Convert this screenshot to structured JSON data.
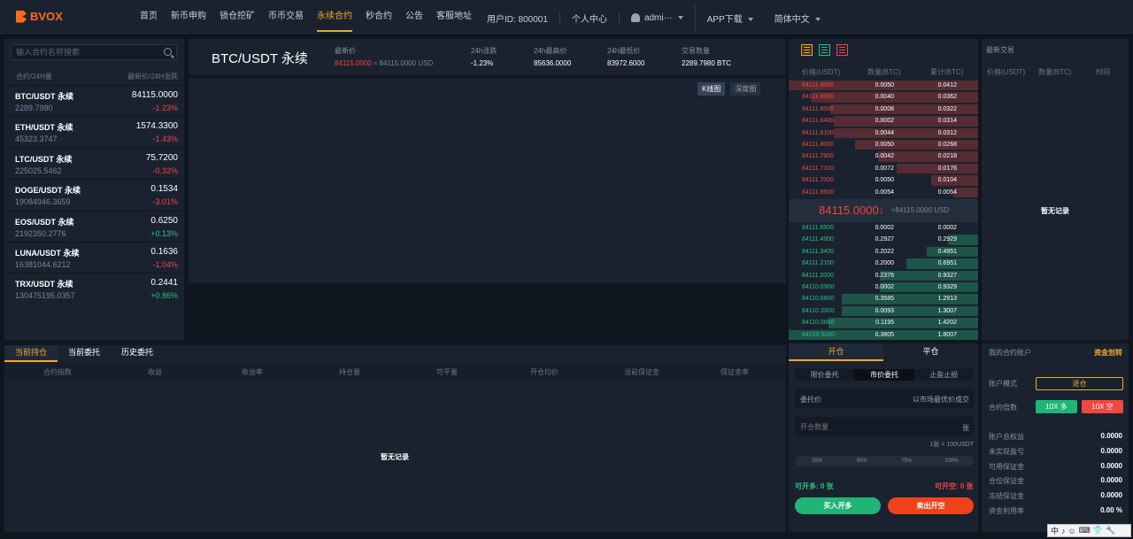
{
  "nav": {
    "logo": "BVOX",
    "items": [
      "首页",
      "新币申购",
      "锁仓挖矿",
      "币币交易",
      "永续合约",
      "秒合约",
      "公告",
      "客服地址"
    ],
    "active_index": 4,
    "user_id": "用户ID: 800001",
    "personal_center": "个人中心",
    "username": "admi···",
    "app_download": "APP下载",
    "language": "简体中文"
  },
  "market": {
    "search_placeholder": "输入合约名称搜索",
    "col_contract": "合约/24H量",
    "col_price": "最新价/24H涨跌",
    "rows": [
      {
        "symbol": "BTC/USDT 永续",
        "volume": "2289.7980",
        "price": "84115.0000",
        "change": "-1.23%",
        "dir": "down"
      },
      {
        "symbol": "ETH/USDT 永续",
        "volume": "45323.3747",
        "price": "1574.3300",
        "change": "-1.43%",
        "dir": "down"
      },
      {
        "symbol": "LTC/USDT 永续",
        "volume": "225025.5462",
        "price": "75.7200",
        "change": "-0.32%",
        "dir": "down"
      },
      {
        "symbol": "DOGE/USDT 永续",
        "volume": "19084946.3659",
        "price": "0.1534",
        "change": "-3.01%",
        "dir": "down"
      },
      {
        "symbol": "EOS/USDT 永续",
        "volume": "2192350.2776",
        "price": "0.6250",
        "change": "+0.13%",
        "dir": "up"
      },
      {
        "symbol": "LUNA/USDT 永续",
        "volume": "16381044.6212",
        "price": "0.1636",
        "change": "-1.04%",
        "dir": "down"
      },
      {
        "symbol": "TRX/USDT 永续",
        "volume": "130475195.0357",
        "price": "0.2441",
        "change": "+0.86%",
        "dir": "up"
      }
    ]
  },
  "ticker": {
    "pair": "BTC/USDT 永续",
    "last_label": "最新价",
    "last_price": "84115.0000",
    "last_usd": "≈ 84115.0000 USD",
    "change_label": "24h涨跌",
    "change": "-1.23%",
    "high_label": "24h最高价",
    "high": "85636.0000",
    "low_label": "24h最低价",
    "low": "83972.6000",
    "vol_label": "交易数量",
    "vol": "2289.7980 BTC"
  },
  "chart": {
    "tabs": [
      "K线图",
      "深度图"
    ],
    "active": 0
  },
  "orderbook": {
    "col_price": "价格(USDT)",
    "col_amount": "数量(BTC)",
    "col_total": "累计(BTC)",
    "colors": {
      "sell": "#f0473e",
      "buy": "#26c281",
      "neutral": "#f0a82b"
    },
    "asks": [
      {
        "price": "84111.9000",
        "amount": "0.0050",
        "total": "0.0412",
        "depth": 1.0
      },
      {
        "price": "84111.8600",
        "amount": "0.0040",
        "total": "0.0362",
        "depth": 0.88
      },
      {
        "price": "84111.8500",
        "amount": "0.0008",
        "total": "0.0322",
        "depth": 0.78
      },
      {
        "price": "84111.8400",
        "amount": "0.0002",
        "total": "0.0314",
        "depth": 0.76
      },
      {
        "price": "84111.8100",
        "amount": "0.0044",
        "total": "0.0312",
        "depth": 0.76
      },
      {
        "price": "84111.8000",
        "amount": "0.0050",
        "total": "0.0268",
        "depth": 0.65
      },
      {
        "price": "84111.7800",
        "amount": "0.0042",
        "total": "0.0218",
        "depth": 0.53
      },
      {
        "price": "84111.7100",
        "amount": "0.0072",
        "total": "0.0176",
        "depth": 0.43
      },
      {
        "price": "84111.7000",
        "amount": "0.0050",
        "total": "0.0104",
        "depth": 0.25
      },
      {
        "price": "84111.6600",
        "amount": "0.0054",
        "total": "0.0054",
        "depth": 0.13
      }
    ],
    "mid_price": "84115.0000",
    "mid_arrow": "↓",
    "mid_usd": "≈84115.0000 USD",
    "bids": [
      {
        "price": "84111.6500",
        "amount": "0.0002",
        "total": "0.0002",
        "depth": 0.0
      },
      {
        "price": "84111.4900",
        "amount": "0.2927",
        "total": "0.2929",
        "depth": 0.16
      },
      {
        "price": "84111.3400",
        "amount": "0.2022",
        "total": "0.4951",
        "depth": 0.27
      },
      {
        "price": "84111.2100",
        "amount": "0.2000",
        "total": "0.6951",
        "depth": 0.38
      },
      {
        "price": "84111.2000",
        "amount": "0.2376",
        "total": "0.9327",
        "depth": 0.52
      },
      {
        "price": "84110.6900",
        "amount": "0.0002",
        "total": "0.9329",
        "depth": 0.52
      },
      {
        "price": "84110.6800",
        "amount": "0.3585",
        "total": "1.2913",
        "depth": 0.72
      },
      {
        "price": "84110.3300",
        "amount": "0.0093",
        "total": "1.3007",
        "depth": 0.72
      },
      {
        "price": "84110.0000",
        "amount": "0.1195",
        "total": "1.4202",
        "depth": 0.79
      },
      {
        "price": "84109.5000",
        "amount": "0.3805",
        "total": "1.8007",
        "depth": 1.0
      }
    ]
  },
  "trades": {
    "title": "最新交易",
    "col_price": "价格(USDT)",
    "col_amount": "数量(BTC)",
    "col_time": "时间",
    "empty": "暂无记录"
  },
  "positions": {
    "tabs": [
      "当前持仓",
      "当前委托",
      "历史委托"
    ],
    "active": 0,
    "columns": [
      "合约指数",
      "收益",
      "收益率",
      "持仓量",
      "可平量",
      "开仓均价",
      "当前保证金",
      "保证金率"
    ],
    "empty": "暂无记录"
  },
  "trade_panel": {
    "tabs": [
      "开仓",
      "平仓"
    ],
    "active": 0,
    "order_types": [
      "限价委托",
      "市价委托",
      "止盈止损"
    ],
    "order_type_active": 1,
    "price_label": "委托价",
    "price_hint": "以市场最优价成交",
    "qty_placeholder": "开仓数量",
    "qty_unit": "张",
    "contract_note": "1张 = 100USDT",
    "percents": [
      "25%",
      "50%",
      "75%",
      "100%"
    ],
    "can_long": "可开多: 0 张",
    "can_short": "可开空: 0 张",
    "buy_button": "买入开多",
    "sell_button": "卖出开空"
  },
  "account": {
    "title": "我的合约账户",
    "transfer": "资金划转",
    "mode_label": "账户模式",
    "mode_value": "逐仓",
    "leverage_label": "合约倍数",
    "leverage_long": "10X 多",
    "leverage_short": "10X 空",
    "rows": [
      {
        "label": "账户总权益",
        "value": "0.0000"
      },
      {
        "label": "未实现盈亏",
        "value": "0.0000"
      },
      {
        "label": "可用保证金",
        "value": "0.0000"
      },
      {
        "label": "仓位保证金",
        "value": "0.0000"
      },
      {
        "label": "冻结保证金",
        "value": "0.0000"
      },
      {
        "label": "资金利用率",
        "value": "0.00 %"
      }
    ]
  },
  "tray": [
    "中",
    "♪",
    "☺",
    "⌨",
    "👕",
    "🔧"
  ]
}
